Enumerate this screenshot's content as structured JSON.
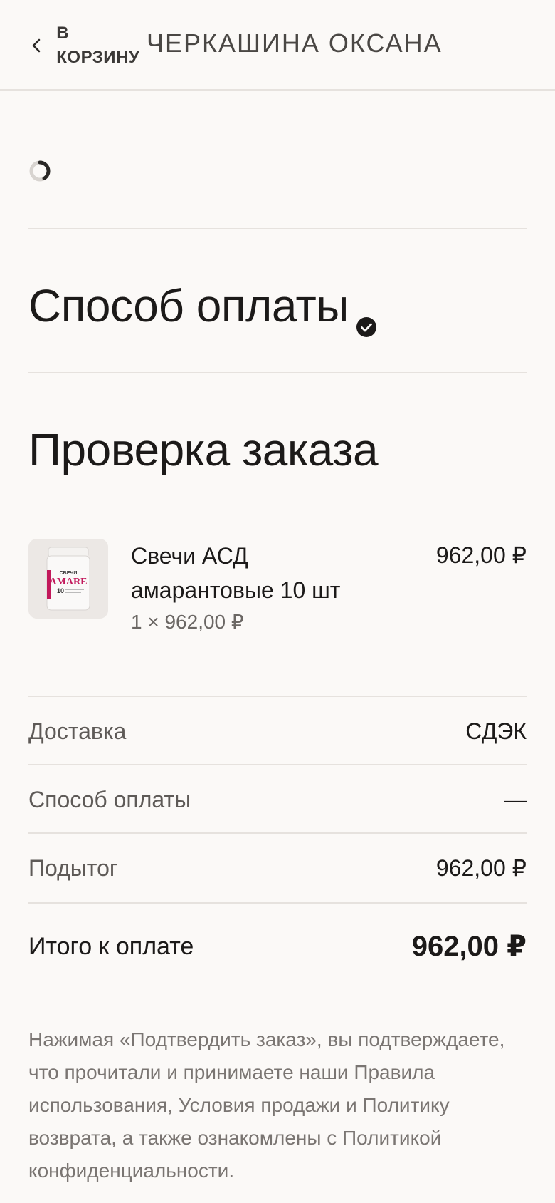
{
  "header": {
    "back_label": "В КОРЗИНУ",
    "store_name": "ЧЕРКАШИНА ОКСАНА"
  },
  "payment_section": {
    "title": "Способ оплаты"
  },
  "review_section": {
    "title": "Проверка заказа"
  },
  "product": {
    "name": "Свечи АСД амарантовые 10 шт",
    "quantity_line": "1 × 962,00 ₽",
    "price": "962,00 ₽",
    "image_text": {
      "top": "СВЕЧИ",
      "brand": "AMARE",
      "count": "10"
    }
  },
  "summary": {
    "delivery_label": "Доставка",
    "delivery_value": "СДЭК",
    "payment_label": "Способ оплаты",
    "payment_value": "—",
    "subtotal_label": "Подытог",
    "subtotal_value": "962,00 ₽",
    "total_label": "Итого к оплате",
    "total_value": "962,00 ₽"
  },
  "terms_text": "Нажимая «Подтвердить заказ», вы подтверждаете, что прочитали и принимаете наши Правила использования, Условия продажи и Политику возврата, а также ознакомлены с Политикой конфиденциальности.",
  "colors": {
    "background": "#fbf9f7",
    "text": "#1c1a19",
    "muted": "#7a7572",
    "divider": "#e6e2de",
    "brand_accent": "#c2185b"
  }
}
